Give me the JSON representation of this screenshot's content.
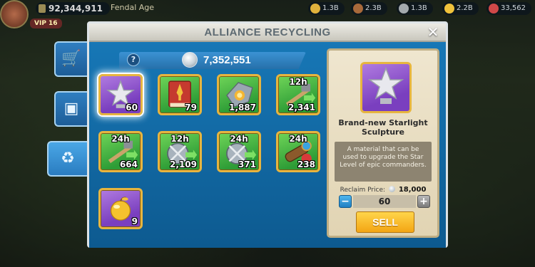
{
  "hud": {
    "power": "92,344,911",
    "player_name": "Fendal Age",
    "vip": "VIP 16",
    "resources": [
      {
        "icon": "food-icon",
        "value": "1.3B",
        "color": "#e1b23c"
      },
      {
        "icon": "wood-icon",
        "value": "2.3B",
        "color": "#a8693a"
      },
      {
        "icon": "stone-icon",
        "value": "1.3B",
        "color": "#a3a9ae"
      },
      {
        "icon": "gold-icon",
        "value": "2.2B",
        "color": "#f0c23b"
      },
      {
        "icon": "gem-icon",
        "value": "33,562",
        "color": "#d04848"
      }
    ]
  },
  "side_tabs": [
    {
      "name": "shop-tab",
      "glyph": "🛒",
      "active": false
    },
    {
      "name": "storage-tab",
      "glyph": "▣",
      "active": false
    },
    {
      "name": "recycling-tab",
      "glyph": "♻",
      "active": true
    }
  ],
  "panel": {
    "title": "ALLIANCE RECYCLING",
    "close": "✕",
    "help": "?",
    "currency_value": "7,352,551"
  },
  "items": [
    {
      "name": "starlight-sculpture",
      "rarity": "purple",
      "count": "60",
      "timer": "",
      "selected": true
    },
    {
      "name": "book-of-covenant",
      "rarity": "green",
      "count": "79",
      "timer": "",
      "selected": false
    },
    {
      "name": "shield-item",
      "rarity": "green",
      "count": "1,887",
      "timer": "",
      "selected": false
    },
    {
      "name": "speedup-12h",
      "rarity": "green",
      "count": "2,341",
      "timer": "12h",
      "selected": false
    },
    {
      "name": "speedup-24h",
      "rarity": "green",
      "count": "664",
      "timer": "24h",
      "selected": false
    },
    {
      "name": "training-speedup-12h",
      "rarity": "green",
      "count": "2,109",
      "timer": "12h",
      "selected": false
    },
    {
      "name": "training-speedup-24h",
      "rarity": "green",
      "count": "371",
      "timer": "24h",
      "selected": false
    },
    {
      "name": "scope-item-24h",
      "rarity": "green",
      "count": "238",
      "timer": "24h",
      "selected": false
    },
    {
      "name": "golden-apple",
      "rarity": "purple",
      "count": "9",
      "timer": "",
      "selected": false
    }
  ],
  "detail": {
    "item_name": "Brand-new Starlight Sculpture",
    "description": "A material that can be used to upgrade the Star Level of epic commanders.",
    "reclaim_label": "Reclaim Price:",
    "reclaim_price": "18,000",
    "quantity": "60",
    "minus": "−",
    "plus": "+",
    "sell_label": "SELL"
  }
}
